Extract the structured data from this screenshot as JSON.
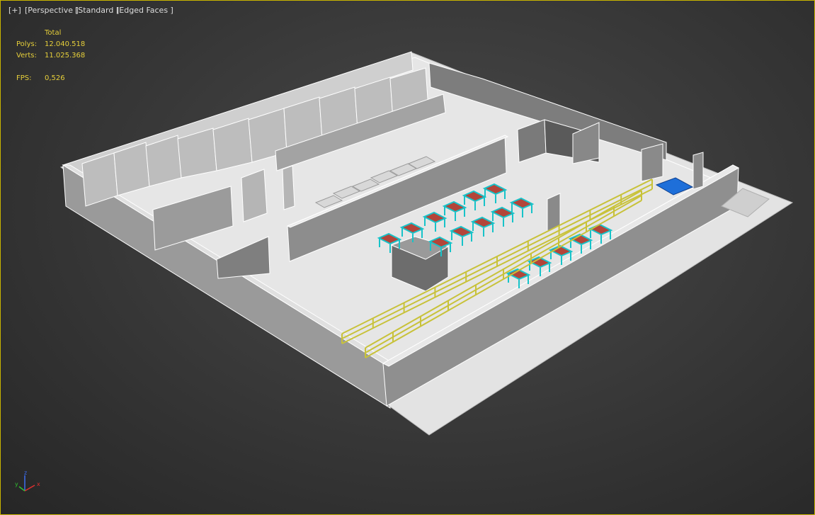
{
  "viewport": {
    "labels": {
      "plus": "[+]",
      "view": "[Perspective ]",
      "shading": "[Standard ]",
      "display": "[Edged Faces ]"
    },
    "stats": {
      "header": "Total",
      "polys_label": "Polys:",
      "polys_value": "12.040.518",
      "verts_label": "Verts:",
      "verts_value": "11.025.368",
      "fps_label": "FPS:",
      "fps_value": "0,526"
    },
    "gizmo": {
      "x": "x",
      "y": "y",
      "z": "z"
    },
    "colors": {
      "border": "#c8b400",
      "stats_text": "#e6cf3a",
      "wall_light": "#d9d9d9",
      "wall_mid": "#8c8c8c",
      "floor": "#e4e4e4",
      "desk_frame": "#17c3c9",
      "desk_top": "#b3453a",
      "rack": "#c8c23a",
      "pallet": "#1e6fd9"
    },
    "scene": {
      "objects": [
        "building-shell",
        "office-rooms",
        "partition-walls",
        "workbenches",
        "racks",
        "column",
        "blue-pallet",
        "floor-grate"
      ]
    }
  }
}
